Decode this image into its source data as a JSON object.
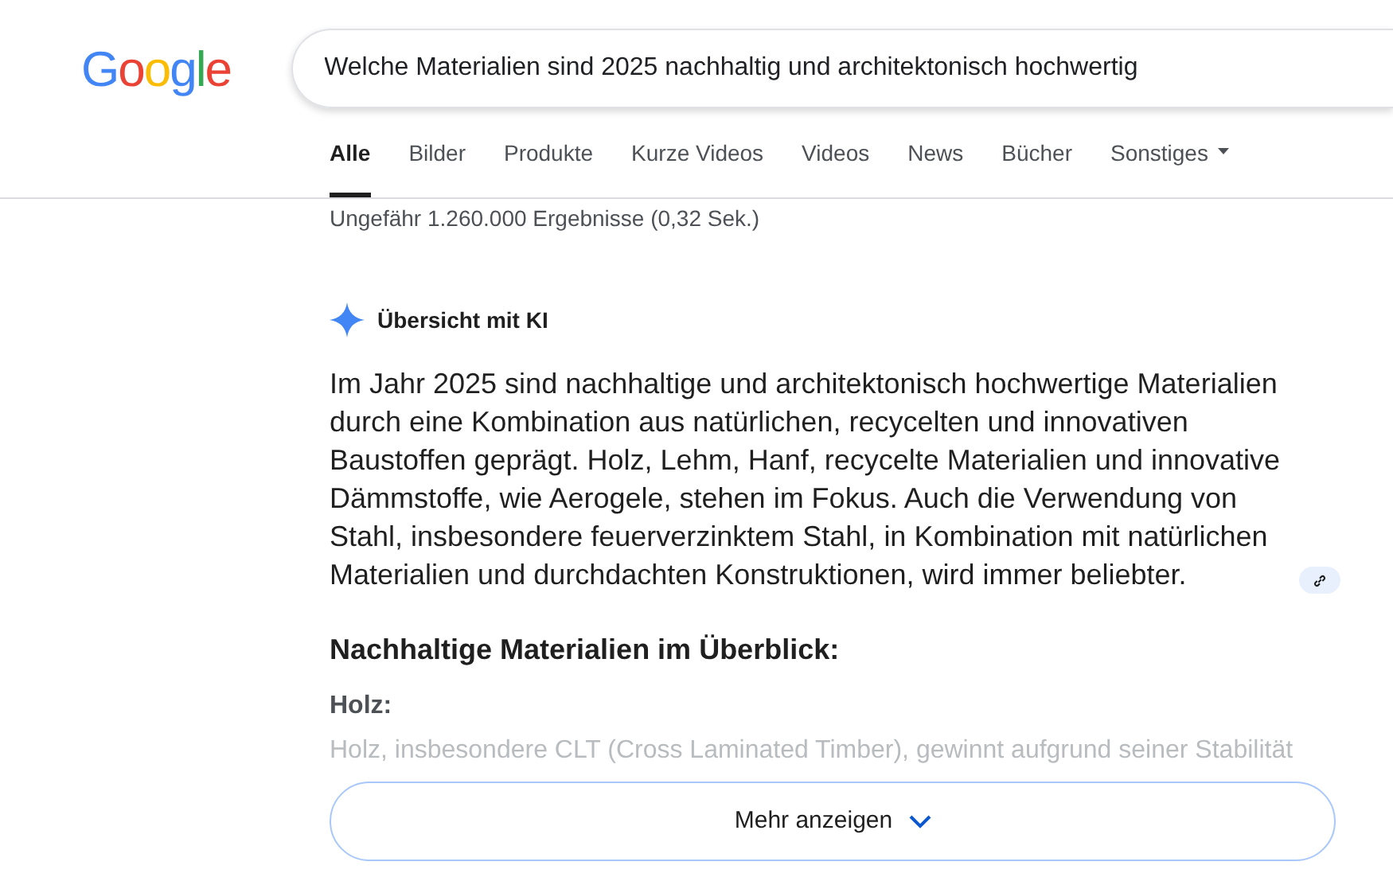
{
  "logo": "Google",
  "search": {
    "value": "Welche Materialien sind 2025 nachhaltig und architektonisch hochwertig"
  },
  "tabs": [
    {
      "label": "Alle",
      "selected": true
    },
    {
      "label": "Bilder",
      "selected": false
    },
    {
      "label": "Produkte",
      "selected": false
    },
    {
      "label": "Kurze Videos",
      "selected": false
    },
    {
      "label": "Videos",
      "selected": false
    },
    {
      "label": "News",
      "selected": false
    },
    {
      "label": "Bücher",
      "selected": false
    },
    {
      "label": "Sonstiges",
      "selected": false,
      "kind": "menu"
    }
  ],
  "result_stats": "Ungefähr 1.260.000 Ergebnisse (0,32 Sek.)",
  "ai_overview": {
    "title": "Übersicht mit KI",
    "summary": "Im Jahr 2025 sind nachhaltige und architektonisch hochwertige Materialien durch eine Kombination aus natürlichen, recycelten und innovativen Baustoffen geprägt. Holz, Lehm, Hanf, recycelte Materialien und innovative Dämmstoffe, wie Aerogele, stehen im Fokus. Auch die Verwendung von Stahl, insbesondere feuerverzinktem Stahl, in Kombination mit natürlichen Materialien und durchdachten Konstruktionen, wird immer beliebter.",
    "heading": "Nachhaltige Materialien im Überblick:",
    "subheading": "Holz:",
    "detail": "Holz, insbesondere CLT (Cross Laminated Timber), gewinnt aufgrund seiner Stabilität",
    "more_button": "Mehr anzeigen"
  }
}
